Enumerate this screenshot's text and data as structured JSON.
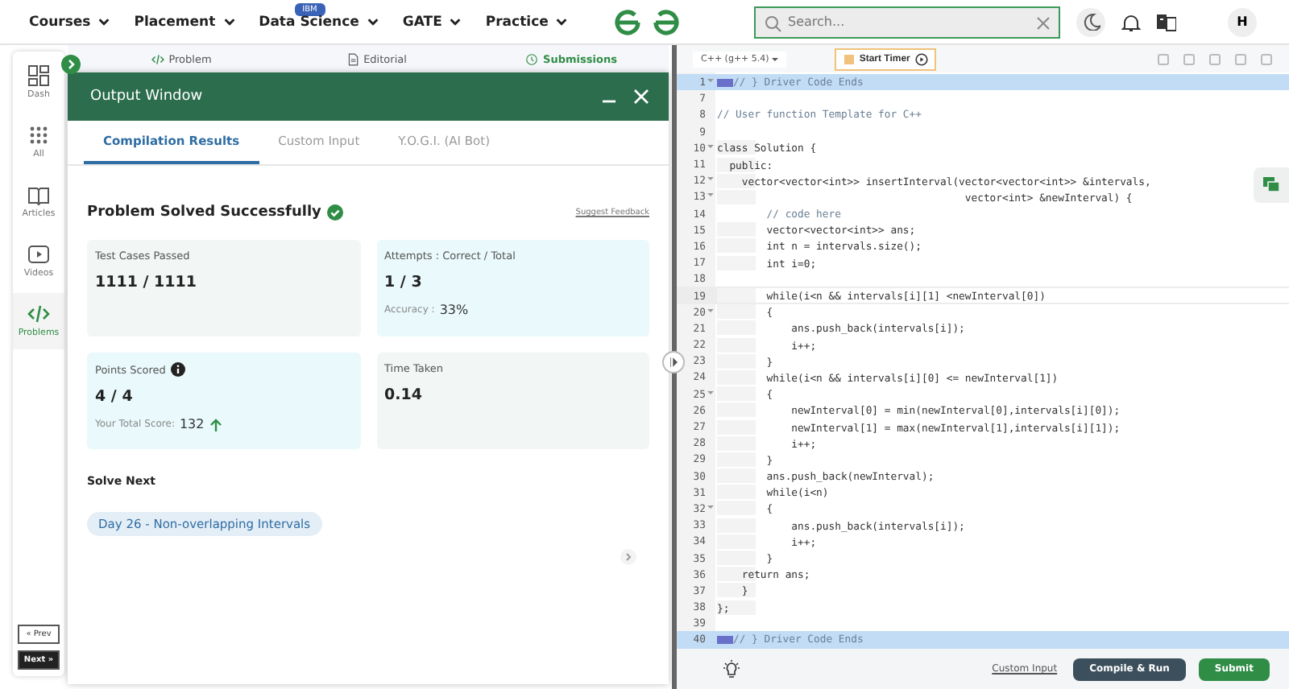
{
  "nav": {
    "items": [
      {
        "label": "Courses"
      },
      {
        "label": "Placement"
      },
      {
        "label": "Data Science",
        "badge": "IBM"
      },
      {
        "label": "GATE"
      },
      {
        "label": "Practice"
      }
    ],
    "search": {
      "placeholder": "Search..."
    },
    "avatar": "H"
  },
  "sidebar": {
    "items": [
      {
        "label": "Dash",
        "selected": false
      },
      {
        "label": "All",
        "selected": false
      },
      {
        "label": "Articles",
        "selected": false
      },
      {
        "label": "Videos",
        "selected": false
      },
      {
        "label": "Problems",
        "selected": true
      }
    ],
    "prev": "« Prev",
    "next": "Next »"
  },
  "problem_tabs": [
    {
      "label": "Problem",
      "selected": false
    },
    {
      "label": "Editorial",
      "selected": false
    },
    {
      "label": "Submissions",
      "selected": true
    }
  ],
  "output_window": {
    "title": "Output Window",
    "tabs": [
      {
        "label": "Compilation Results",
        "selected": true
      },
      {
        "label": "Custom Input",
        "selected": false
      },
      {
        "label": "Y.O.G.I. (AI Bot)",
        "selected": false
      }
    ],
    "status": "Problem Solved Successfully",
    "feedback": "Suggest Feedback",
    "cards": [
      {
        "label": "Test Cases Passed",
        "value": "1111 / 1111",
        "color": "#f2f6f4"
      },
      {
        "label": "Attempts : Correct / Total",
        "value": "1 / 3",
        "note_label": "Accuracy :",
        "note_value": "33%",
        "color": "#eaf9fc"
      },
      {
        "label": "Points Scored",
        "info": true,
        "value": "4 / 4",
        "note_label": "Your Total Score:",
        "note_value": "132",
        "rising": true,
        "color": "#eaf9fc"
      },
      {
        "label": "Time Taken",
        "value": "0.14",
        "color": "#f2f6f4"
      }
    ],
    "solve_next": {
      "heading": "Solve Next",
      "chips": [
        "Day 26 - Non-overlapping Intervals"
      ]
    }
  },
  "editor": {
    "language": "C++ (g++ 5.4)",
    "timer": "Start Timer",
    "lines": [
      {
        "num": "1",
        "fold": true,
        "kind": "comment",
        "folded": true,
        "highlight": true,
        "text": "// } Driver Code Ends"
      },
      {
        "num": "7",
        "fold": false,
        "highlight": false
      },
      {
        "num": "8",
        "fold": false,
        "kind": "comment",
        "highlight": false,
        "text": "// User function Template for C++"
      },
      {
        "num": "9",
        "fold": false,
        "highlight": false
      },
      {
        "num": "10",
        "fold": true,
        "kind": "code",
        "highlight": false,
        "text": "class Solution {"
      },
      {
        "num": "11",
        "fold": false,
        "kind": "code",
        "highlight": false,
        "text": "  public:"
      },
      {
        "num": "12",
        "fold": true,
        "kind": "code",
        "highlight": false,
        "text": "    vector<vector<int>> insertInterval(vector<vector<int>> &intervals,"
      },
      {
        "num": "13",
        "fold": true,
        "kind": "code",
        "highlight": false,
        "text": "                                        vector<int> &newInterval) {"
      },
      {
        "num": "14",
        "fold": false,
        "kind": "comment",
        "highlight": false,
        "text": "        // code here"
      },
      {
        "num": "15",
        "fold": false,
        "kind": "code",
        "highlight": false,
        "text": "        vector<vector<int>> ans;"
      },
      {
        "num": "16",
        "fold": false,
        "kind": "code",
        "highlight": false,
        "text": "        int n = intervals.size();"
      },
      {
        "num": "17",
        "fold": false,
        "kind": "code",
        "highlight": false,
        "text": "        int i=0;"
      },
      {
        "num": "18",
        "fold": false,
        "highlight": false
      },
      {
        "num": "19",
        "fold": false,
        "kind": "code",
        "highlight": false,
        "current": true,
        "text": "        while(i<n && intervals[i][1] <newInterval[0])"
      },
      {
        "num": "20",
        "fold": true,
        "kind": "code",
        "highlight": false,
        "text": "        {"
      },
      {
        "num": "21",
        "fold": false,
        "kind": "code",
        "highlight": false,
        "text": "            ans.push_back(intervals[i]);"
      },
      {
        "num": "22",
        "fold": false,
        "kind": "code",
        "highlight": false,
        "text": "            i++;"
      },
      {
        "num": "23",
        "fold": false,
        "kind": "code",
        "highlight": false,
        "text": "        }"
      },
      {
        "num": "24",
        "fold": false,
        "kind": "code",
        "highlight": false,
        "text": "        while(i<n && intervals[i][0] <= newInterval[1])"
      },
      {
        "num": "25",
        "fold": true,
        "kind": "code",
        "highlight": false,
        "text": "        {"
      },
      {
        "num": "26",
        "fold": false,
        "kind": "code",
        "highlight": false,
        "text": "            newInterval[0] = min(newInterval[0],intervals[i][0]);"
      },
      {
        "num": "27",
        "fold": false,
        "kind": "code",
        "highlight": false,
        "text": "            newInterval[1] = max(newInterval[1],intervals[i][1]);"
      },
      {
        "num": "28",
        "fold": false,
        "kind": "code",
        "highlight": false,
        "text": "            i++;"
      },
      {
        "num": "29",
        "fold": false,
        "kind": "code",
        "highlight": false,
        "text": "        }"
      },
      {
        "num": "30",
        "fold": false,
        "kind": "code",
        "highlight": false,
        "text": "        ans.push_back(newInterval);"
      },
      {
        "num": "31",
        "fold": false,
        "kind": "code",
        "highlight": false,
        "text": "        while(i<n)"
      },
      {
        "num": "32",
        "fold": true,
        "kind": "code",
        "highlight": false,
        "text": "        {"
      },
      {
        "num": "33",
        "fold": false,
        "kind": "code",
        "highlight": false,
        "text": "            ans.push_back(intervals[i]);"
      },
      {
        "num": "34",
        "fold": false,
        "kind": "code",
        "highlight": false,
        "text": "            i++;"
      },
      {
        "num": "35",
        "fold": false,
        "kind": "code",
        "highlight": false,
        "text": "        }"
      },
      {
        "num": "36",
        "fold": false,
        "kind": "code",
        "highlight": false,
        "text": "    return ans;"
      },
      {
        "num": "37",
        "fold": false,
        "kind": "code",
        "highlight": false,
        "text": "    }"
      },
      {
        "num": "38",
        "fold": false,
        "kind": "code",
        "highlight": false,
        "text": "};"
      },
      {
        "num": "39",
        "fold": false,
        "highlight": false
      },
      {
        "num": "40",
        "fold": false,
        "kind": "comment",
        "folded": true,
        "highlight": true,
        "text": "// } Driver Code Ends"
      }
    ],
    "custom_input": "Custom Input",
    "compile": "Compile & Run",
    "submit": "Submit"
  }
}
